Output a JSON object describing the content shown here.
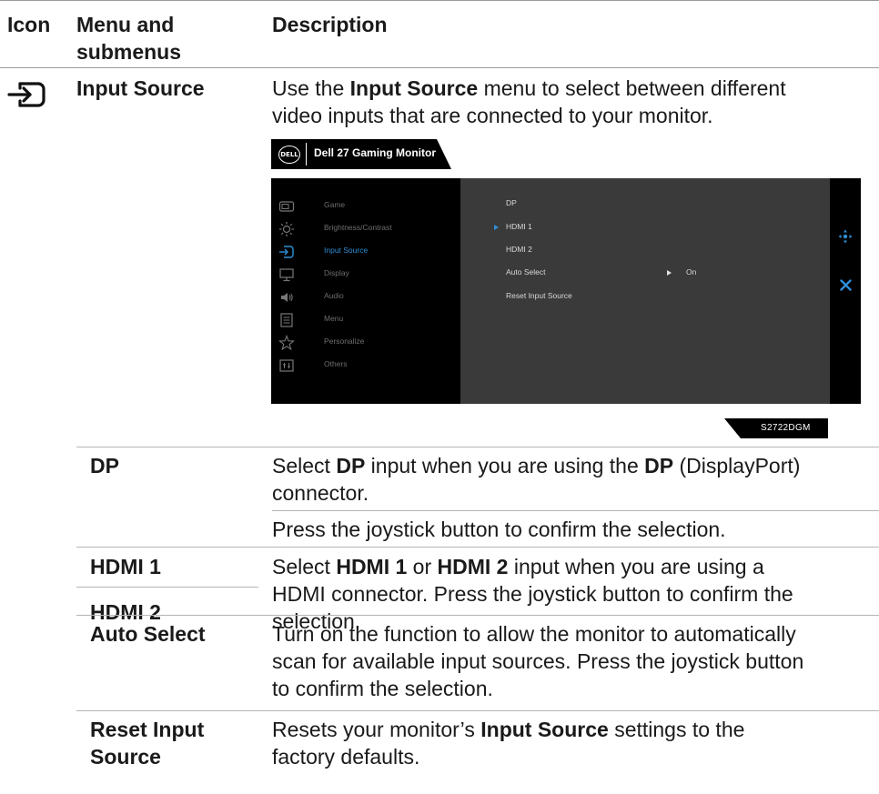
{
  "header": {
    "col_icon": "Icon",
    "col_menu_1": "Menu and",
    "col_menu_2": "submenus",
    "col_desc": "Description"
  },
  "input_source": {
    "label": "Input Source",
    "icon": "input-source-icon",
    "desc_pre": "Use the ",
    "desc_bold": "Input Source",
    "desc_post_1": " menu to select between different",
    "desc_line2": "video inputs that are connected to your monitor."
  },
  "osd": {
    "logo": "DELL",
    "title": "Dell 27 Gaming Monitor",
    "menu": [
      {
        "label": "Game",
        "icon": "game-icon"
      },
      {
        "label": "Brightness/Contrast",
        "icon": "brightness-icon"
      },
      {
        "label": "Input Source",
        "icon": "input-source-icon"
      },
      {
        "label": "Display",
        "icon": "display-icon"
      },
      {
        "label": "Audio",
        "icon": "audio-icon"
      },
      {
        "label": "Menu",
        "icon": "menu-icon"
      },
      {
        "label": "Personalize",
        "icon": "star-icon"
      },
      {
        "label": "Others",
        "icon": "others-icon"
      }
    ],
    "submenu": {
      "dp": "DP",
      "hdmi1": "HDMI 1",
      "hdmi2": "HDMI 2",
      "auto_select": "Auto Select",
      "auto_select_value": "On",
      "reset": "Reset Input Source"
    },
    "model": "S2722DGM",
    "accent": "#2f8fd8"
  },
  "rows": {
    "dp": {
      "label": "DP",
      "d1_a": "Select ",
      "d1_b": "DP",
      "d1_c": " input when you are using the ",
      "d1_d": "DP",
      "d1_e": " (DisplayPort)",
      "d2": "connector.",
      "d3": "Press the joystick button to confirm the selection."
    },
    "hdmi": {
      "label1": "HDMI 1",
      "label2": "HDMI 2",
      "d1_a": "Select ",
      "d1_b": "HDMI 1",
      "d1_c": " or ",
      "d1_d": "HDMI 2",
      "d1_e": " input when you are using a",
      "d2": "HDMI connector. Press the joystick button to confirm the",
      "d3": "selection."
    },
    "auto": {
      "label": "Auto Select",
      "d1": "Turn on the function to allow the monitor to automatically",
      "d2": "scan for available input sources. Press the joystick button",
      "d3": "to confirm the selection."
    },
    "reset": {
      "label1": "Reset Input",
      "label2": "Source",
      "d1_a": "Resets your monitor’s ",
      "d1_b": "Input Source",
      "d1_c": " settings to the",
      "d2": "factory defaults."
    }
  }
}
